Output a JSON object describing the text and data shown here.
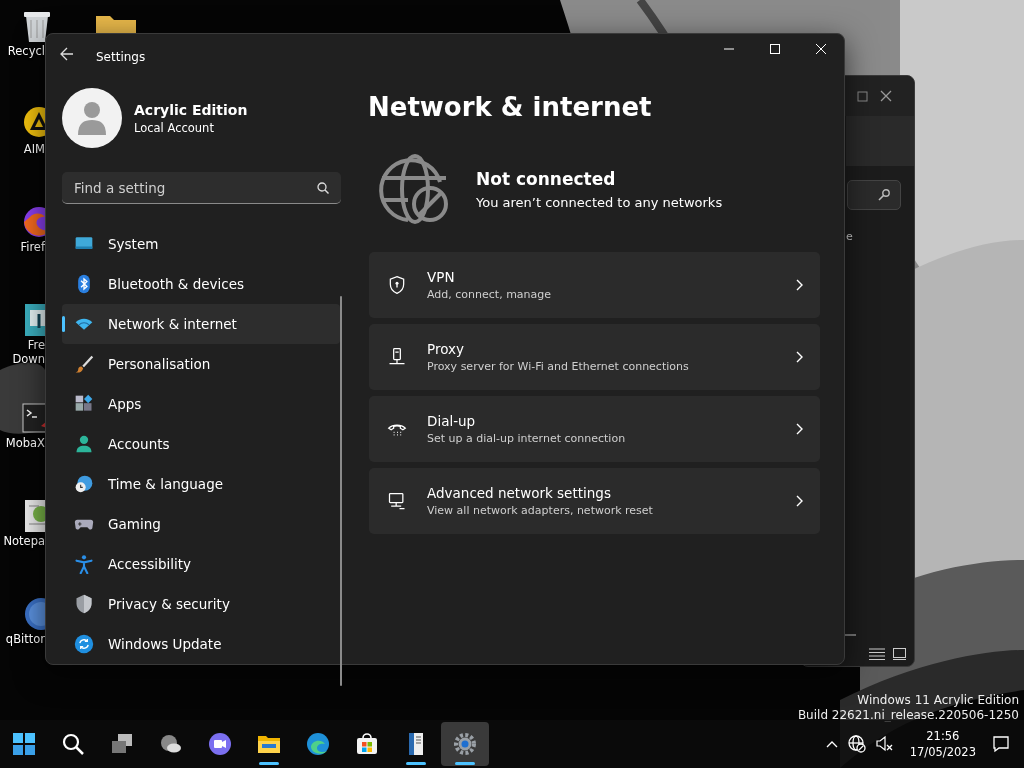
{
  "desktop": {
    "icons": [
      {
        "kind": "recycle",
        "lines": [
          "Recycl"
        ]
      },
      {
        "kind": "aim",
        "lines": [
          "AIM"
        ]
      },
      {
        "kind": "firefox",
        "lines": [
          "Firef"
        ]
      },
      {
        "kind": "fdm",
        "lines": [
          "Fre",
          "Down"
        ]
      },
      {
        "kind": "terminal",
        "lines": [
          "MobaX"
        ]
      },
      {
        "kind": "notepad",
        "lines": [
          "Notepa"
        ]
      },
      {
        "kind": "qbit",
        "lines": [
          "qBittor"
        ]
      }
    ]
  },
  "background_window": {
    "text": "e"
  },
  "settings_window": {
    "title": "Settings",
    "account": {
      "name": "Acrylic Edition",
      "type": "Local Account"
    },
    "search": {
      "placeholder": "Find a setting"
    },
    "nav": [
      {
        "kind": "system",
        "label": "System",
        "selected": false
      },
      {
        "kind": "bluetooth",
        "label": "Bluetooth & devices",
        "selected": false
      },
      {
        "kind": "network",
        "label": "Network & internet",
        "selected": true
      },
      {
        "kind": "personalisation",
        "label": "Personalisation",
        "selected": false
      },
      {
        "kind": "apps",
        "label": "Apps",
        "selected": false
      },
      {
        "kind": "accounts",
        "label": "Accounts",
        "selected": false
      },
      {
        "kind": "time",
        "label": "Time & language",
        "selected": false
      },
      {
        "kind": "gaming",
        "label": "Gaming",
        "selected": false
      },
      {
        "kind": "accessibility",
        "label": "Accessibility",
        "selected": false
      },
      {
        "kind": "privacy",
        "label": "Privacy & security",
        "selected": false
      },
      {
        "kind": "update",
        "label": "Windows Update",
        "selected": false
      }
    ],
    "heading": "Network & internet",
    "status": {
      "title": "Not connected",
      "message": "You aren’t connected to any networks"
    },
    "cards": [
      {
        "kind": "vpn",
        "title": "VPN",
        "subtitle": "Add, connect, manage"
      },
      {
        "kind": "proxy",
        "title": "Proxy",
        "subtitle": "Proxy server for Wi-Fi and Ethernet connections"
      },
      {
        "kind": "dialup",
        "title": "Dial-up",
        "subtitle": "Set up a dial-up internet connection"
      },
      {
        "kind": "advanced",
        "title": "Advanced network settings",
        "subtitle": "View all network adapters, network reset"
      }
    ]
  },
  "watermark": [
    "Windows 11 Acrylic Edition",
    "Build 22621.ni_release.220506-1250"
  ],
  "taskbar": {
    "apps": [
      {
        "kind": "start",
        "running": false,
        "selected": false
      },
      {
        "kind": "search",
        "running": false,
        "selected": false
      },
      {
        "kind": "taskview",
        "running": false,
        "selected": false
      },
      {
        "kind": "weather",
        "running": false,
        "selected": false
      },
      {
        "kind": "chat",
        "running": false,
        "selected": false
      },
      {
        "kind": "explorer",
        "running": true,
        "selected": false
      },
      {
        "kind": "edge",
        "running": false,
        "selected": false
      },
      {
        "kind": "store",
        "running": false,
        "selected": false
      },
      {
        "kind": "book",
        "running": true,
        "selected": false
      },
      {
        "kind": "settings",
        "running": true,
        "selected": true
      }
    ],
    "tray": {
      "time": "21:56",
      "date": "17/05/2023"
    }
  }
}
